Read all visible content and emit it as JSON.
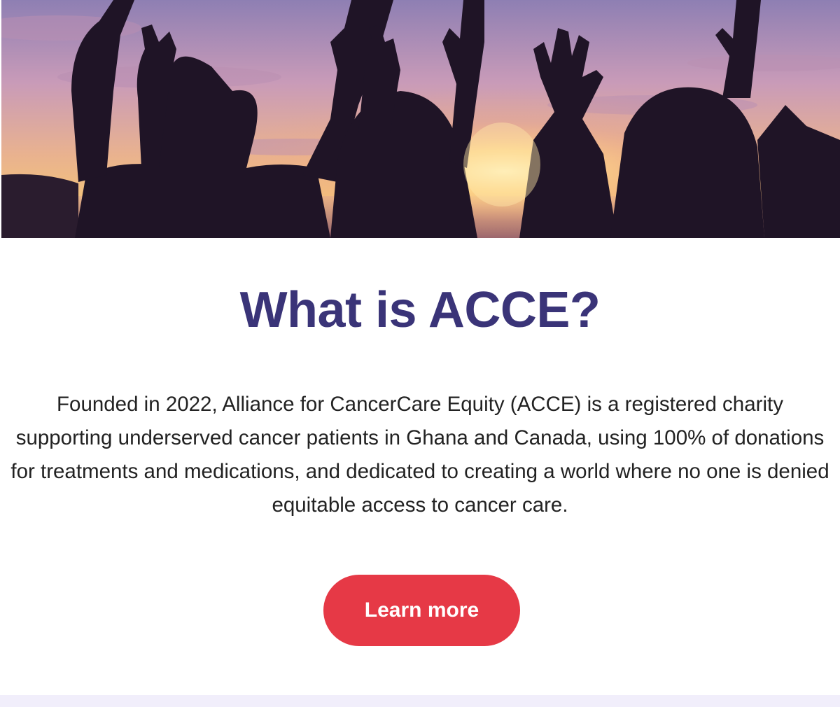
{
  "hero": {
    "image": "silhouettes-raising-hands-at-sunset"
  },
  "section": {
    "title": "What is ACCE?",
    "description": "Founded in 2022, Alliance for CancerCare Equity (ACCE) is a registered charity supporting underserved cancer patients in Ghana and Canada, using 100% of donations for treatments and medications, and dedicated to creating a world where no one is denied equitable access to cancer care.",
    "cta_label": "Learn more"
  },
  "colors": {
    "title": "#3a3478",
    "text": "#222222",
    "cta_bg": "#e63946",
    "cta_text": "#ffffff",
    "bottom_band": "#f1eefb",
    "background": "#ffffff"
  }
}
